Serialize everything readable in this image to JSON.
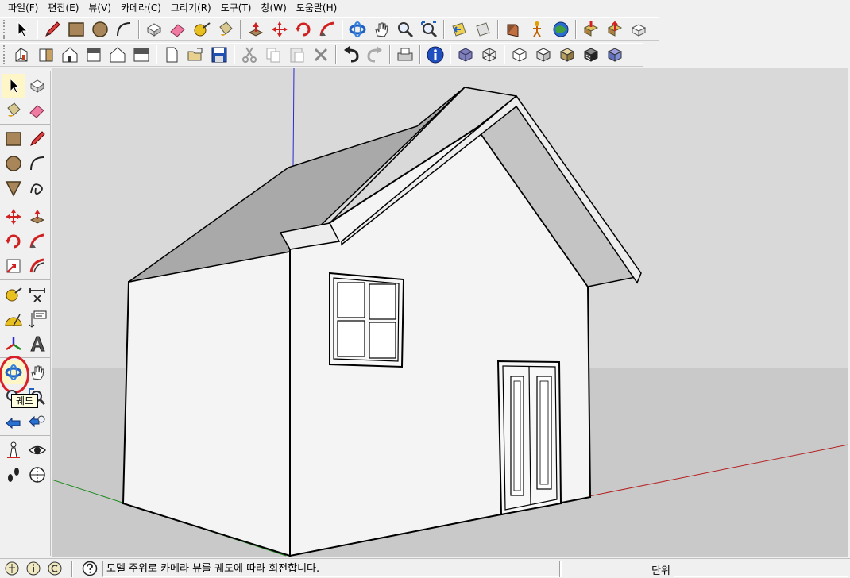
{
  "menu": [
    "파일(F)",
    "편집(E)",
    "뷰(V)",
    "카메라(C)",
    "그리기(R)",
    "도구(T)",
    "창(W)",
    "도움말(H)"
  ],
  "tooltip": "궤도",
  "status": {
    "message": "모델 주위로 카메라 뷰를 궤도에 따라 회전합니다.",
    "units_label": "단위",
    "units_value": ""
  },
  "colors": {
    "sky": "#d9d9d9",
    "ground": "#c9c9c9",
    "wall": "#f4f4f4",
    "roof": "#a9a9a9",
    "axis_red": "#b52020",
    "axis_green": "#1f8a1f",
    "axis_blue": "#2a2ad0",
    "highlight": "#d8202a"
  },
  "icons": {
    "toolbar1": [
      "select-arrow-icon",
      "pencil-icon",
      "rectangle-icon",
      "circle-icon",
      "arc-icon",
      "eraser-box-icon",
      "eraser-icon",
      "tape-measure-icon",
      "paint-bucket-icon",
      "push-pull-icon",
      "move-icon",
      "rotate-icon",
      "follow-me-icon",
      "orbit-icon",
      "pan-hand-icon",
      "zoom-icon",
      "zoom-extents-icon",
      "previous-view-icon",
      "next-view-icon",
      "position-camera-icon",
      "walk-icon",
      "google-earth-icon",
      "get-models-icon",
      "share-model-icon",
      "component-icon"
    ],
    "toolbar2": [
      "iso-view-icon",
      "front-view-icon",
      "top-view-icon",
      "right-view-icon",
      "back-view-icon",
      "left-view-icon",
      "new-file-icon",
      "open-file-icon",
      "save-icon",
      "cut-icon",
      "copy-icon",
      "paste-icon",
      "delete-icon",
      "undo-icon",
      "redo-icon",
      "print-icon",
      "model-info-icon",
      "xray-icon",
      "wireframe-icon",
      "hidden-line-icon",
      "shaded-icon",
      "shaded-texture-icon",
      "monochrome-icon",
      "style-box-icon"
    ]
  }
}
